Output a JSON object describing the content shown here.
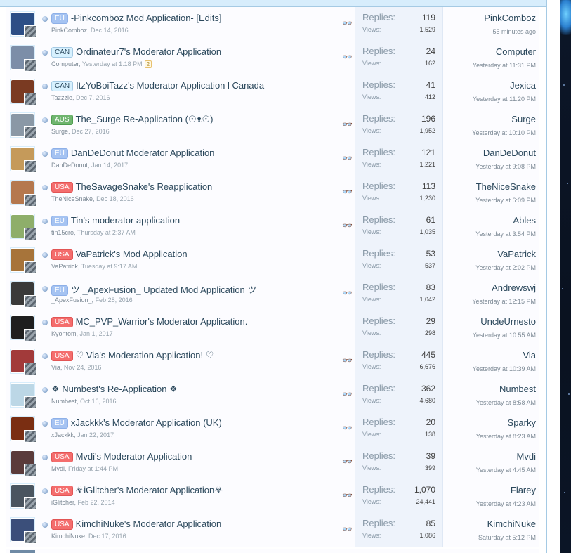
{
  "threads": [
    {
      "prefix": "EU",
      "prefix_class": "eu",
      "title": "-Pinkcomboz Mod Application- [Edits]",
      "author": "PinkComboz",
      "date": "Dec 14, 2016",
      "replies": "119",
      "views": "1,529",
      "last_user": "PinkComboz",
      "last_time": "55 minutes ago",
      "watched": true,
      "pages": "",
      "avatar": "#2d4f86"
    },
    {
      "prefix": "CAN",
      "prefix_class": "can",
      "title": "Ordinateur7's Moderator Application",
      "author": "Computer",
      "date": "Yesterday at 1:18 PM",
      "replies": "24",
      "views": "162",
      "last_user": "Computer",
      "last_time": "Yesterday at 11:31 PM",
      "watched": true,
      "pages": "2",
      "avatar": "#7c8ea8"
    },
    {
      "prefix": "CAN",
      "prefix_class": "can",
      "title": "ItzYoBoiTazz's Moderator Application l Canada",
      "author": "Tazzzle",
      "date": "Dec 7, 2016",
      "replies": "41",
      "views": "412",
      "last_user": "Jexica",
      "last_time": "Yesterday at 11:20 PM",
      "watched": false,
      "pages": "",
      "avatar": "#7a3a22"
    },
    {
      "prefix": "AUS",
      "prefix_class": "aus",
      "title": "The_Surge Re-Application (☉ᴥ☉)",
      "author": "Surge",
      "date": "Dec 27, 2016",
      "replies": "196",
      "views": "1,952",
      "last_user": "Surge",
      "last_time": "Yesterday at 10:10 PM",
      "watched": true,
      "pages": "",
      "avatar": "#8a98a6"
    },
    {
      "prefix": "EU",
      "prefix_class": "eu",
      "title": "DanDeDonut Moderator Application",
      "author": "DanDeDonut",
      "date": "Jan 14, 2017",
      "replies": "121",
      "views": "1,221",
      "last_user": "DanDeDonut",
      "last_time": "Yesterday at 9:08 PM",
      "watched": true,
      "pages": "",
      "avatar": "#c59a5a"
    },
    {
      "prefix": "USA",
      "prefix_class": "usa",
      "title": "TheSavageSnake's Reapplication",
      "author": "TheNiceSnake",
      "date": "Dec 18, 2016",
      "replies": "113",
      "views": "1,230",
      "last_user": "TheNiceSnake",
      "last_time": "Yesterday at 6:09 PM",
      "watched": true,
      "pages": "",
      "avatar": "#b5784e"
    },
    {
      "prefix": "EU",
      "prefix_class": "eu",
      "title": "Tin's moderator application",
      "author": "tin15cro",
      "date": "Thursday at 2:37 AM",
      "replies": "61",
      "views": "1,035",
      "last_user": "Ables",
      "last_time": "Yesterday at 3:54 PM",
      "watched": true,
      "pages": "",
      "avatar": "#8eae6a"
    },
    {
      "prefix": "USA",
      "prefix_class": "usa",
      "title": "VaPatrick's Mod Application",
      "author": "VaPatrick",
      "date": "Tuesday at 9:17 AM",
      "replies": "53",
      "views": "537",
      "last_user": "VaPatrick",
      "last_time": "Yesterday at 2:02 PM",
      "watched": false,
      "pages": "",
      "avatar": "#a7743a"
    },
    {
      "prefix": "EU",
      "prefix_class": "eu",
      "title": "ツ _ApexFusion_ Updated Mod Application ツ",
      "author": "_ApexFusion_",
      "date": "Feb 28, 2016",
      "replies": "83",
      "views": "1,042",
      "last_user": "Andrewswj",
      "last_time": "Yesterday at 12:15 PM",
      "watched": true,
      "pages": "",
      "avatar": "#3a3a3a"
    },
    {
      "prefix": "USA",
      "prefix_class": "usa",
      "title": "MC_PVP_Warrior's Moderator Application.",
      "author": "Kyontom",
      "date": "Jan 1, 2017",
      "replies": "29",
      "views": "298",
      "last_user": "UncleUrnesto",
      "last_time": "Yesterday at 10:55 AM",
      "watched": false,
      "pages": "",
      "avatar": "#1f1f1f"
    },
    {
      "prefix": "USA",
      "prefix_class": "usa",
      "title": "♡ Via's Moderation Application! ♡",
      "author": "Via",
      "date": "Nov 24, 2016",
      "replies": "445",
      "views": "6,676",
      "last_user": "Via",
      "last_time": "Yesterday at 10:39 AM",
      "watched": true,
      "pages": "",
      "avatar": "#a23a3a"
    },
    {
      "prefix": "",
      "prefix_class": "",
      "title": "❖ Numbest's Re-Application ❖",
      "author": "Numbest",
      "date": "Oct 16, 2016",
      "replies": "362",
      "views": "4,680",
      "last_user": "Numbest",
      "last_time": "Yesterday at 8:58 AM",
      "watched": true,
      "pages": "",
      "avatar": "#bcd7e6"
    },
    {
      "prefix": "EU",
      "prefix_class": "eu",
      "title": "xJackkk's Moderator Application (UK)",
      "author": "xJackkk",
      "date": "Jan 22, 2017",
      "replies": "20",
      "views": "138",
      "last_user": "Sparky",
      "last_time": "Yesterday at 8:23 AM",
      "watched": true,
      "pages": "",
      "avatar": "#7a2e12"
    },
    {
      "prefix": "USA",
      "prefix_class": "usa",
      "title": "Mvdi's Moderator Application",
      "author": "Mvdi",
      "date": "Friday at 1:44 PM",
      "replies": "39",
      "views": "399",
      "last_user": "Mvdi",
      "last_time": "Yesterday at 4:45 AM",
      "watched": true,
      "pages": "",
      "avatar": "#5a3b3b"
    },
    {
      "prefix": "USA",
      "prefix_class": "usa",
      "title": "☣iGlitcher's Moderator Application☣",
      "author": "iGlitcher",
      "date": "Feb 22, 2014",
      "replies": "1,070",
      "views": "24,441",
      "last_user": "Flarey",
      "last_time": "Yesterday at 4:23 AM",
      "watched": true,
      "pages": "",
      "avatar": "#4a5560"
    },
    {
      "prefix": "USA",
      "prefix_class": "usa",
      "title": "KimchiNuke's Moderator Application",
      "author": "KimchiNuke",
      "date": "Dec 17, 2016",
      "replies": "85",
      "views": "1,086",
      "last_user": "KimchiNuke",
      "last_time": "Saturday at 5:12 PM",
      "watched": true,
      "pages": "",
      "avatar": "#3b4f7a"
    }
  ],
  "labels": {
    "replies": "Replies:",
    "views": "Views:"
  },
  "icons": {
    "bullet": "thread-status-icon",
    "watch": "glasses-icon"
  }
}
